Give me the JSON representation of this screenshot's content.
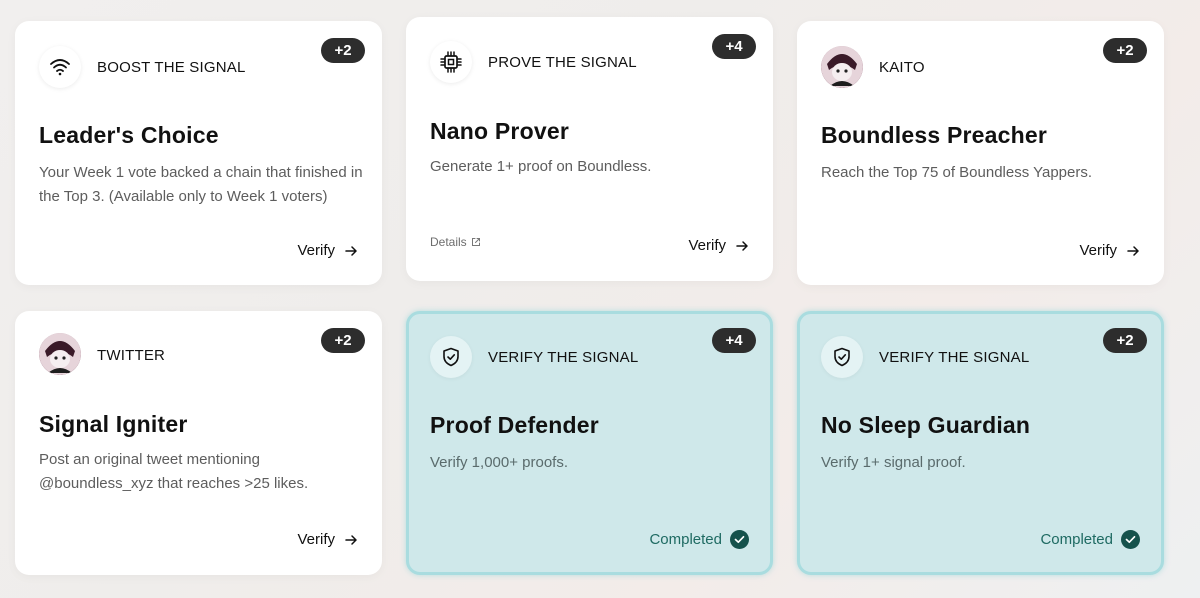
{
  "cards": [
    {
      "badge": "+2",
      "category": "BOOST THE SIGNAL",
      "icon": "wifi-icon",
      "title": "Leader's Choice",
      "description": "Your Week 1 vote backed a chain that finished in the Top 3. (Available only to Week 1 voters)",
      "action": "Verify"
    },
    {
      "badge": "+4",
      "category": "PROVE THE SIGNAL",
      "icon": "chip-icon",
      "title": "Nano Prover",
      "description": "Generate 1+ proof on Boundless.",
      "details": "Details",
      "action": "Verify"
    },
    {
      "badge": "+2",
      "category": "KAITO",
      "icon": "avatar",
      "title": "Boundless Preacher",
      "description": "Reach the Top 75 of Boundless Yappers.",
      "action": "Verify"
    },
    {
      "badge": "+2",
      "category": "TWITTER",
      "icon": "avatar",
      "title": "Signal Igniter",
      "description": "Post an original tweet mentioning @boundless_xyz that reaches >25 likes.",
      "action": "Verify"
    },
    {
      "badge": "+4",
      "category": "VERIFY THE SIGNAL",
      "icon": "shield-check-icon",
      "title": "Proof Defender",
      "description": "Verify 1,000+ proofs.",
      "status": "Completed"
    },
    {
      "badge": "+2",
      "category": "VERIFY THE SIGNAL",
      "icon": "shield-check-icon",
      "title": "No Sleep Guardian",
      "description": "Verify 1+ signal proof.",
      "status": "Completed"
    }
  ],
  "colors": {
    "completed_bg": "#cfe8ea",
    "completed_text": "#1e6a62",
    "badge_bg": "#2d2d2d"
  }
}
